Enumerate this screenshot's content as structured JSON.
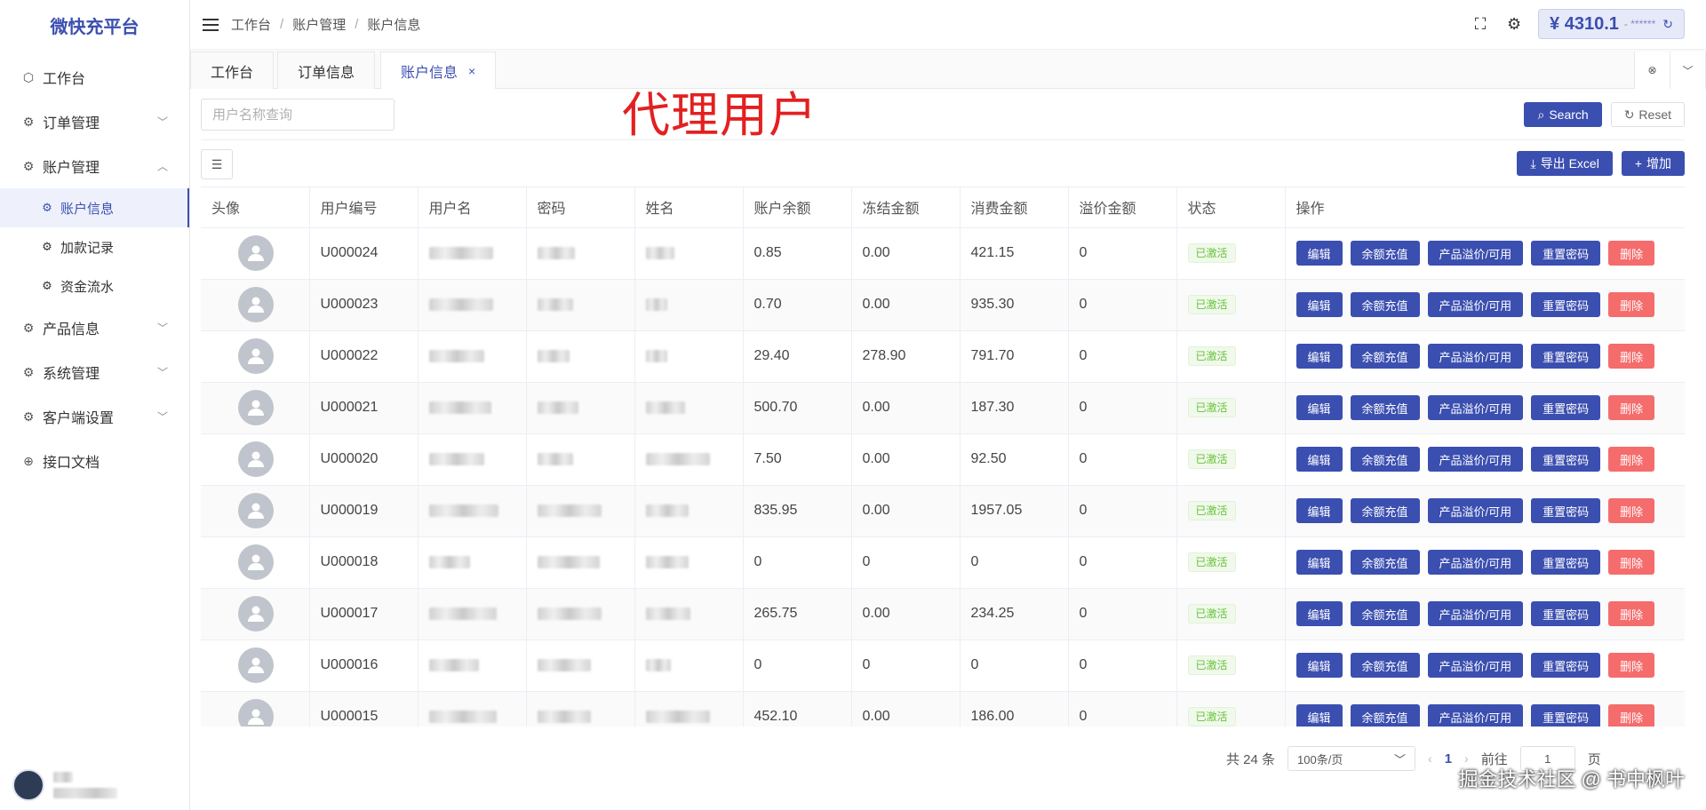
{
  "sidebar": {
    "logo": "微快充平台",
    "menu": [
      {
        "label": "工作台",
        "icon": "dashboard-icon"
      },
      {
        "label": "订单管理",
        "icon": "settings-icon"
      },
      {
        "label": "账户管理",
        "icon": "settings-icon"
      },
      {
        "label": "产品信息",
        "icon": "settings-icon"
      },
      {
        "label": "系统管理",
        "icon": "settings-icon"
      },
      {
        "label": "客户端设置",
        "icon": "settings-icon"
      },
      {
        "label": "接口文档",
        "icon": "globe-icon"
      }
    ],
    "account_sub": [
      "账户信息",
      "加款记录",
      "资金流水"
    ]
  },
  "header": {
    "breadcrumb": [
      "工作台",
      "账户管理",
      "账户信息"
    ],
    "balance": "¥ 4310.1",
    "balance_mask": "- ******"
  },
  "tabs": [
    {
      "label": "工作台"
    },
    {
      "label": "订单信息"
    },
    {
      "label": "账户信息",
      "active": true,
      "close": "×"
    }
  ],
  "search": {
    "placeholder": "用户名称查询",
    "overlay_label": "代理用户",
    "search_btn": "Search",
    "reset_btn": "Reset"
  },
  "toolbar": {
    "export_btn": "导出 Excel",
    "add_btn": "增加"
  },
  "table": {
    "headers": [
      "头像",
      "用户编号",
      "用户名",
      "密码",
      "姓名",
      "账户余额",
      "冻结金额",
      "消费金额",
      "溢价金额",
      "状态",
      "操作"
    ],
    "actions": {
      "edit": "编辑",
      "recharge": "余额充值",
      "premium": "产品溢价/可用",
      "reset_pwd": "重置密码",
      "delete": "删除"
    },
    "rows": [
      {
        "id": "U000024",
        "balance": "0.85",
        "frozen": "0.00",
        "spent": "421.15",
        "premium": "0",
        "status": "已激活"
      },
      {
        "id": "U000023",
        "balance": "0.70",
        "frozen": "0.00",
        "spent": "935.30",
        "premium": "0",
        "status": "已激活"
      },
      {
        "id": "U000022",
        "balance": "29.40",
        "frozen": "278.90",
        "spent": "791.70",
        "premium": "0",
        "status": "已激活"
      },
      {
        "id": "U000021",
        "balance": "500.70",
        "frozen": "0.00",
        "spent": "187.30",
        "premium": "0",
        "status": "已激活"
      },
      {
        "id": "U000020",
        "balance": "7.50",
        "frozen": "0.00",
        "spent": "92.50",
        "premium": "0",
        "status": "已激活"
      },
      {
        "id": "U000019",
        "balance": "835.95",
        "frozen": "0.00",
        "spent": "1957.05",
        "premium": "0",
        "status": "已激活"
      },
      {
        "id": "U000018",
        "balance": "0",
        "frozen": "0",
        "spent": "0",
        "premium": "0",
        "status": "已激活"
      },
      {
        "id": "U000017",
        "balance": "265.75",
        "frozen": "0.00",
        "spent": "234.25",
        "premium": "0",
        "status": "已激活"
      },
      {
        "id": "U000016",
        "balance": "0",
        "frozen": "0",
        "spent": "0",
        "premium": "0",
        "status": "已激活"
      },
      {
        "id": "U000015",
        "balance": "452.10",
        "frozen": "0.00",
        "spent": "186.00",
        "premium": "0",
        "status": "已激活"
      }
    ]
  },
  "pagination": {
    "total": "共 24 条",
    "page_size": "100条/页",
    "current": "1",
    "goto_label": "前往",
    "goto_value": "1",
    "page_suffix": "页"
  },
  "watermark": "掘金技术社区 @ 书中枫叶",
  "colors": {
    "primary": "#3b4fb0",
    "danger": "#f56c6c",
    "success": "#67c23a",
    "overlay_text": "#e32020"
  }
}
